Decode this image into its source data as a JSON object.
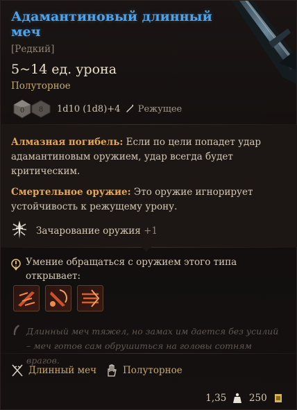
{
  "item": {
    "name": "Адамантиновый длинный меч",
    "rarity": "[Редкий]",
    "damage": "5~14 ед. урона",
    "handedness": "Полуторное",
    "dice": {
      "die_a": "0",
      "die_b": "8",
      "formula": "1d10 (1d8)+4",
      "damage_type": "Режущее"
    }
  },
  "properties": [
    {
      "name": "Алмазная погибель:",
      "text": " Если по цели попадет удар адамантиновым оружием, удар всегда будет критическим."
    },
    {
      "name": "Смертельное оружие:",
      "text": " Это оружие игнорирует устойчивость к режущему урону."
    }
  ],
  "enchantment": {
    "label": "Зачарование оружия",
    "value": "+1"
  },
  "proficiency": {
    "text": "Умение обращаться с оружием этого типа открывает:",
    "actions": [
      "lacerate-action-icon",
      "pommel-strike-action-icon",
      "flourish-action-icon"
    ]
  },
  "flavor": "Длинный меч тяжел, но замах им дается без усилий – меч готов сам обрушиться на головы сотням врагов.",
  "tags": [
    {
      "icon": "longsword-icon",
      "label": "Длинный меч"
    },
    {
      "icon": "versatile-hand-icon",
      "label": "Полуторное"
    }
  ],
  "footer": {
    "weight": "1,35",
    "price": "250"
  },
  "colors": {
    "title": "#4ea3e8",
    "accent": "#e2a85a",
    "gold": "#c9a86a"
  }
}
